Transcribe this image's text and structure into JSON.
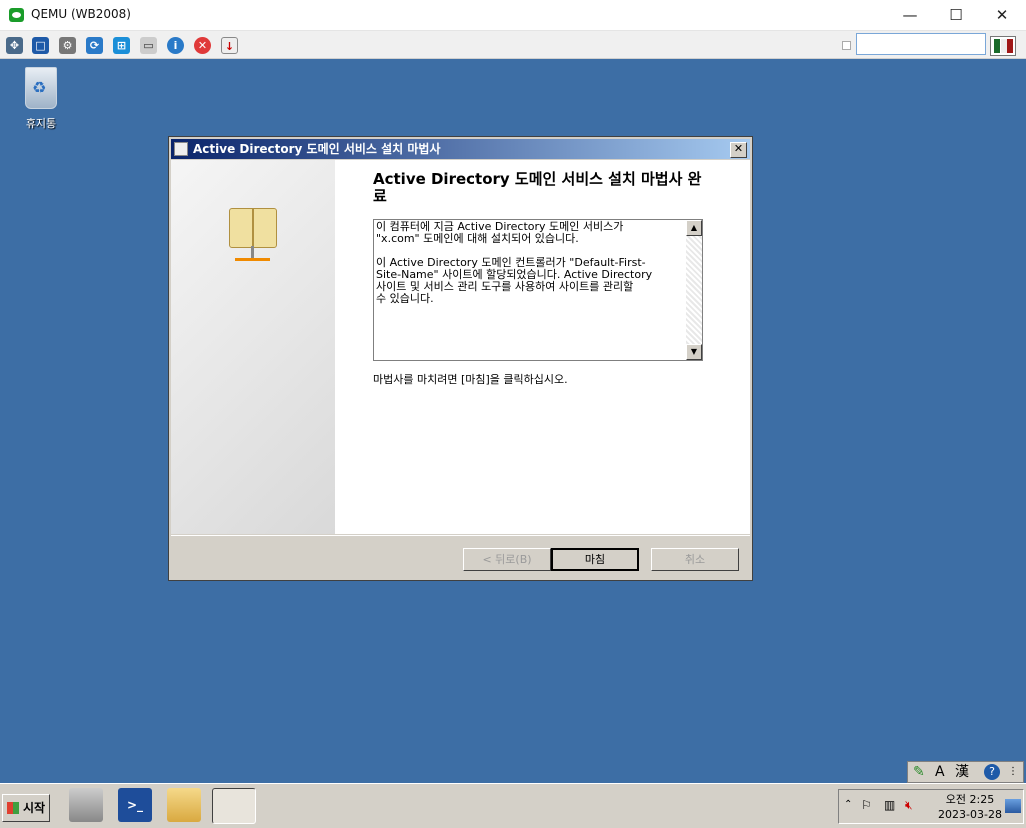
{
  "host": {
    "title": "QEMU (WB2008)",
    "window_buttons": [
      "—",
      "☐",
      "✕"
    ],
    "toolbar_icons": [
      "network-icon",
      "fullscreen-icon",
      "settings-icon",
      "refresh-icon",
      "windows-icon",
      "disk-icon",
      "info-icon",
      "stop-icon",
      "screenshot-icon"
    ],
    "search_value": ""
  },
  "desktop": {
    "recycle_bin_label": "휴지통"
  },
  "dialog": {
    "title": "Active Directory 도메인 서비스 설치 마법사",
    "close_label": "✕",
    "heading": "Active Directory 도메인 서비스 설치 마법사 완료",
    "summary": "이 컴퓨터에 지금 Active Directory 도메인 서비스가\n\"x.com\" 도메인에 대해 설치되어 있습니다.\n\n이 Active Directory 도메인 컨트롤러가 \"Default-First-\nSite-Name\" 사이트에 할당되었습니다. Active Directory\n사이트 및 서비스 관리 도구를 사용하여 사이트를 관리할\n수 있습니다.",
    "scroll_up": "▲",
    "scroll_down": "▼",
    "finish_hint": "마법사를 마치려면 [마침]을 클릭하십시오.",
    "buttons": {
      "back": "< 뒤로(B)",
      "finish": "마침",
      "cancel": "취소"
    }
  },
  "taskbar": {
    "start_label": "시작",
    "tray_icons": [
      "chevron-up-icon",
      "flag-icon",
      "network-icon",
      "speaker-muted-icon"
    ],
    "time": "오전 2:25",
    "date": "2023-03-28"
  },
  "language_bar": {
    "items": [
      "A",
      "漢",
      "?"
    ]
  }
}
